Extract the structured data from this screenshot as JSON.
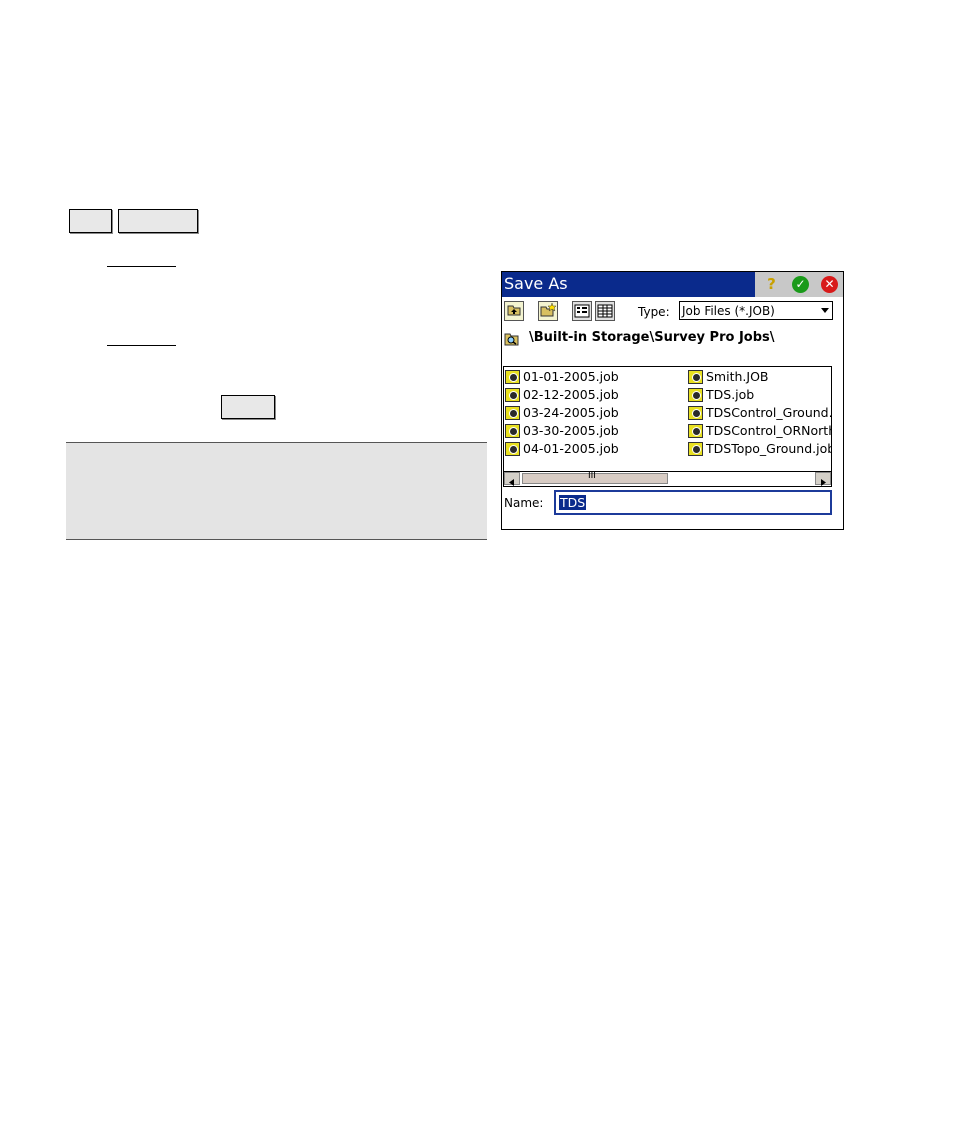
{
  "dialog": {
    "title": "Save As",
    "title_buttons": [
      "help-icon",
      "ok-icon",
      "close-icon"
    ],
    "type_label": "Type:",
    "type_value": "Job Files (*.JOB)",
    "path": "\\Built-in Storage\\Survey Pro Jobs\\",
    "files_left": [
      "01-01-2005.job",
      "02-12-2005.job",
      "03-24-2005.job",
      "03-30-2005.job",
      "04-01-2005.job"
    ],
    "files_right": [
      "Smith.JOB",
      "TDS.job",
      "TDSControl_Ground.",
      "TDSControl_ORNorth",
      "TDSTopo_Ground.job"
    ],
    "scroll_glyph": "III",
    "name_label": "Name:",
    "name_value": "TDS"
  },
  "colors": {
    "titlebar": "#0a2a8c",
    "selection": "#0a2a8c",
    "note_bg": "#e4e4e4"
  }
}
